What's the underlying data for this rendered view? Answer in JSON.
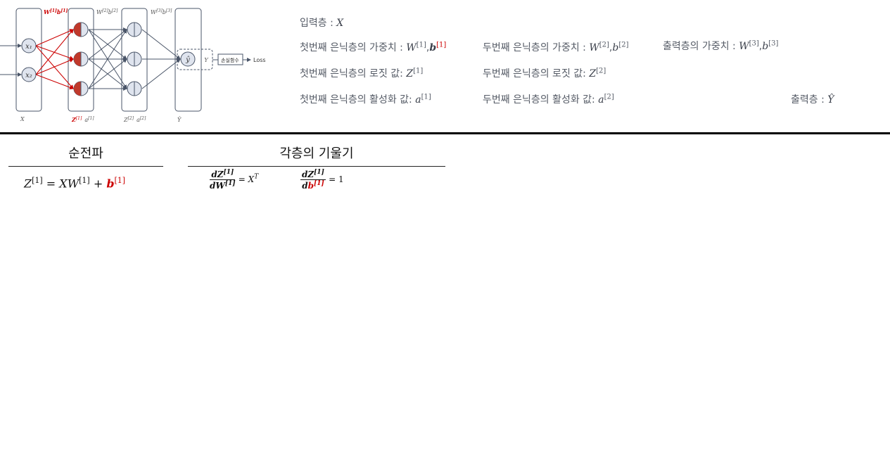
{
  "diagram": {
    "top_labels": {
      "w1": "W",
      "w1_sup": "[1]",
      "b1": "b",
      "b1_sup": "[1]",
      "w2": "W",
      "w2_sup": "[2]",
      "b2": "b",
      "b2_sup": "[2]",
      "w3": "W",
      "w3_sup": "[3]",
      "b3": "b",
      "b3_sup": "[3]"
    },
    "inputs": [
      "x₁",
      "x₂"
    ],
    "output_node": "ŷ",
    "target_label": "Y",
    "loss_box": "손실함수",
    "loss_label": "Loss",
    "bottom_labels": {
      "x": "X",
      "z1": "Z",
      "z1_sup": "[1]",
      "a1": "a",
      "a1_sup": "[1]",
      "z2": "Z",
      "z2_sup": "[2]",
      "a2": "a",
      "a2_sup": "[2]",
      "yhat": "Ŷ"
    },
    "colors": {
      "accent": "#cc0000",
      "node_fill": "#dfe4ee",
      "stroke": "#4a5568",
      "red_half": "#c0392b"
    }
  },
  "legend": {
    "input_layer": {
      "label": "입력층 :",
      "symbol": "X"
    },
    "hidden1_weights": {
      "label": "첫번째 은닉층의 가중치 :",
      "w": "W",
      "w_sup": "[1]",
      "sep": ",",
      "b": "b",
      "b_sup": "[1]"
    },
    "hidden2_weights": {
      "label": "두번째 은닉층의 가중치 :",
      "w": "W",
      "w_sup": "[2]",
      "sep": ",",
      "b": "b",
      "b_sup": "[2]"
    },
    "output_weights": {
      "label": "출력층의 가중치 :",
      "w": "W",
      "w_sup": "[3]",
      "sep": ",",
      "b": "b",
      "b_sup": "[3]"
    },
    "hidden1_logit": {
      "label": "첫번째 은닉층의 로짓 값:",
      "sym": "Z",
      "sup": "[1]"
    },
    "hidden2_logit": {
      "label": "두번째 은닉층의 로짓 값:",
      "sym": "Z",
      "sup": "[2]"
    },
    "hidden1_activation": {
      "label": "첫번째 은닉층의 활성화 값:",
      "sym": "a",
      "sup": "[1]"
    },
    "hidden2_activation": {
      "label": "두번째 은닉층의 활성화 값:",
      "sym": "a",
      "sup": "[2]"
    },
    "output_layer": {
      "label": "출력층 :",
      "sym": "Ŷ"
    }
  },
  "sections": {
    "forward": {
      "title": "순전파",
      "eq": {
        "lhs": "Z",
        "lhs_sup": "[1]",
        "eqsign": " = ",
        "x": "XW",
        "w_sup": "[1]",
        "plus": " + ",
        "b": "b",
        "b_sup": "[1]"
      }
    },
    "gradients": {
      "title": "각층의 기울기",
      "g1": {
        "num": "dZ",
        "num_sup": "[1]",
        "den": "dW",
        "den_sup": "[1]",
        "rhs": "= X",
        "rhs_sup": "T"
      },
      "g2": {
        "num": "dZ",
        "num_sup": "[1]",
        "den_d": "d",
        "den_b": "b",
        "den_sup": "[1]",
        "rhs": "= 1"
      }
    }
  }
}
